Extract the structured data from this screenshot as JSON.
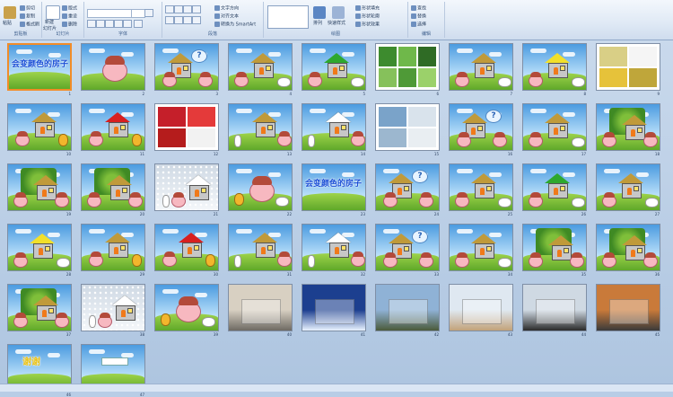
{
  "ribbon": {
    "clipboard": {
      "paste": "粘贴",
      "cut": "剪切",
      "copy": "复制",
      "format_painter": "格式刷",
      "group_label": "剪贴板"
    },
    "slides": {
      "new_slide": "新建",
      "new_slide_2": "幻灯片",
      "layout": "版式",
      "reset": "重设",
      "delete": "删除",
      "group_label": "幻灯片"
    },
    "font": {
      "font_name": "",
      "font_size": "",
      "group_label": "字体"
    },
    "paragraph": {
      "text_direction": "文字方向",
      "align_text": "对齐文本",
      "smartart": "转换为 SmartArt",
      "group_label": "段落"
    },
    "drawing": {
      "arrange": "排列",
      "quick_styles": "快速样式",
      "shape_fill": "形状填充",
      "shape_outline": "形状轮廓",
      "shape_effects": "形状效果",
      "group_label": "绘图"
    },
    "editing": {
      "find": "查找",
      "replace": "替换",
      "select": "选择",
      "group_label": "编辑"
    }
  },
  "slides": [
    {
      "num": "1",
      "type": "title",
      "title_art": "会变颜色的房子",
      "selected": true
    },
    {
      "num": "2",
      "type": "pig"
    },
    {
      "num": "3",
      "type": "house-question",
      "roof": "#c09a3a"
    },
    {
      "num": "4",
      "type": "house-pigs",
      "roof": "#c09a3a"
    },
    {
      "num": "5",
      "type": "house-green",
      "roof": "#2ea82e"
    },
    {
      "num": "6",
      "type": "photos",
      "photo_colors": [
        "#3d8b2e",
        "#6fb84a",
        "#2f6b25",
        "#86c15b",
        "#4f9a37",
        "#9bd16a"
      ]
    },
    {
      "num": "7",
      "type": "house-pigs",
      "roof": "#c09a3a"
    },
    {
      "num": "8",
      "type": "house-yellow",
      "roof": "#f2e02a"
    },
    {
      "num": "9",
      "type": "photos",
      "photo_colors": [
        "#d9cf86",
        "#f5f5f5",
        "#e6c23a",
        "#bfa63a"
      ]
    },
    {
      "num": "10",
      "type": "house-chick",
      "roof": "#c09a3a"
    },
    {
      "num": "11",
      "type": "house-chick",
      "roof": "#d81f1f"
    },
    {
      "num": "12",
      "type": "photos",
      "photo_colors": [
        "#c51f2a",
        "#e43a3a",
        "#b51c1c",
        "#f2f2f2"
      ]
    },
    {
      "num": "13",
      "type": "house-rabbit",
      "roof": "#c09a3a"
    },
    {
      "num": "14",
      "type": "house-rabbit",
      "roof": "#ffffff"
    },
    {
      "num": "15",
      "type": "photos",
      "photo_colors": [
        "#7aa3c9",
        "#d9e3ec",
        "#9cb7cf",
        "#e9eef2"
      ]
    },
    {
      "num": "16",
      "type": "house-question",
      "roof": "#c09a3a"
    },
    {
      "num": "17",
      "type": "house-pigs",
      "roof": "#c09a3a"
    },
    {
      "num": "18",
      "type": "vine-house",
      "roof": "#c09a3a"
    },
    {
      "num": "19",
      "type": "vine-house",
      "roof": "#c09a3a"
    },
    {
      "num": "20",
      "type": "vine-house",
      "roof": "#c09a3a"
    },
    {
      "num": "21",
      "type": "snow-house",
      "roof": "#ffffff"
    },
    {
      "num": "22",
      "type": "pig"
    },
    {
      "num": "23",
      "type": "title",
      "title_art": "会变颜色的房子"
    },
    {
      "num": "24",
      "type": "house-question",
      "roof": "#c09a3a"
    },
    {
      "num": "25",
      "type": "house-pigs",
      "roof": "#c09a3a"
    },
    {
      "num": "26",
      "type": "house-green",
      "roof": "#2ea82e"
    },
    {
      "num": "27",
      "type": "house-pigs",
      "roof": "#c09a3a"
    },
    {
      "num": "28",
      "type": "house-yellow",
      "roof": "#f2e02a"
    },
    {
      "num": "29",
      "type": "house-chick",
      "roof": "#c09a3a"
    },
    {
      "num": "30",
      "type": "house-chick",
      "roof": "#d81f1f"
    },
    {
      "num": "31",
      "type": "house-rabbit",
      "roof": "#c09a3a"
    },
    {
      "num": "32",
      "type": "house-rabbit",
      "roof": "#ffffff"
    },
    {
      "num": "33",
      "type": "house-question",
      "roof": "#c09a3a"
    },
    {
      "num": "34",
      "type": "house-pigs",
      "roof": "#c09a3a"
    },
    {
      "num": "35",
      "type": "vine-house",
      "roof": "#c09a3a"
    },
    {
      "num": "36",
      "type": "vine-house",
      "roof": "#c09a3a"
    },
    {
      "num": "37",
      "type": "vine-house",
      "roof": "#c09a3a"
    },
    {
      "num": "38",
      "type": "snow-house",
      "roof": "#ffffff"
    },
    {
      "num": "39",
      "type": "pig"
    },
    {
      "num": "40",
      "type": "photo-full",
      "photo_colors": [
        "#d8d0c2",
        "#6e6a63"
      ]
    },
    {
      "num": "41",
      "type": "photo-full",
      "photo_colors": [
        "#1c3f8f",
        "#e9f3ff"
      ]
    },
    {
      "num": "42",
      "type": "photo-full",
      "photo_colors": [
        "#8fb2d6",
        "#4a5a3a"
      ]
    },
    {
      "num": "43",
      "type": "photo-full",
      "photo_colors": [
        "#dfe8f1",
        "#c2a27a"
      ]
    },
    {
      "num": "44",
      "type": "photo-full",
      "photo_colors": [
        "#cfd9e3",
        "#2a2a2a"
      ]
    },
    {
      "num": "45",
      "type": "photo-full",
      "photo_colors": [
        "#c97a3a",
        "#3a3a3a"
      ]
    },
    {
      "num": "46",
      "type": "end",
      "title_art": "谢谢"
    },
    {
      "num": "47",
      "type": "end2",
      "title_art": ""
    }
  ],
  "status_bar": {
    "text": ""
  }
}
